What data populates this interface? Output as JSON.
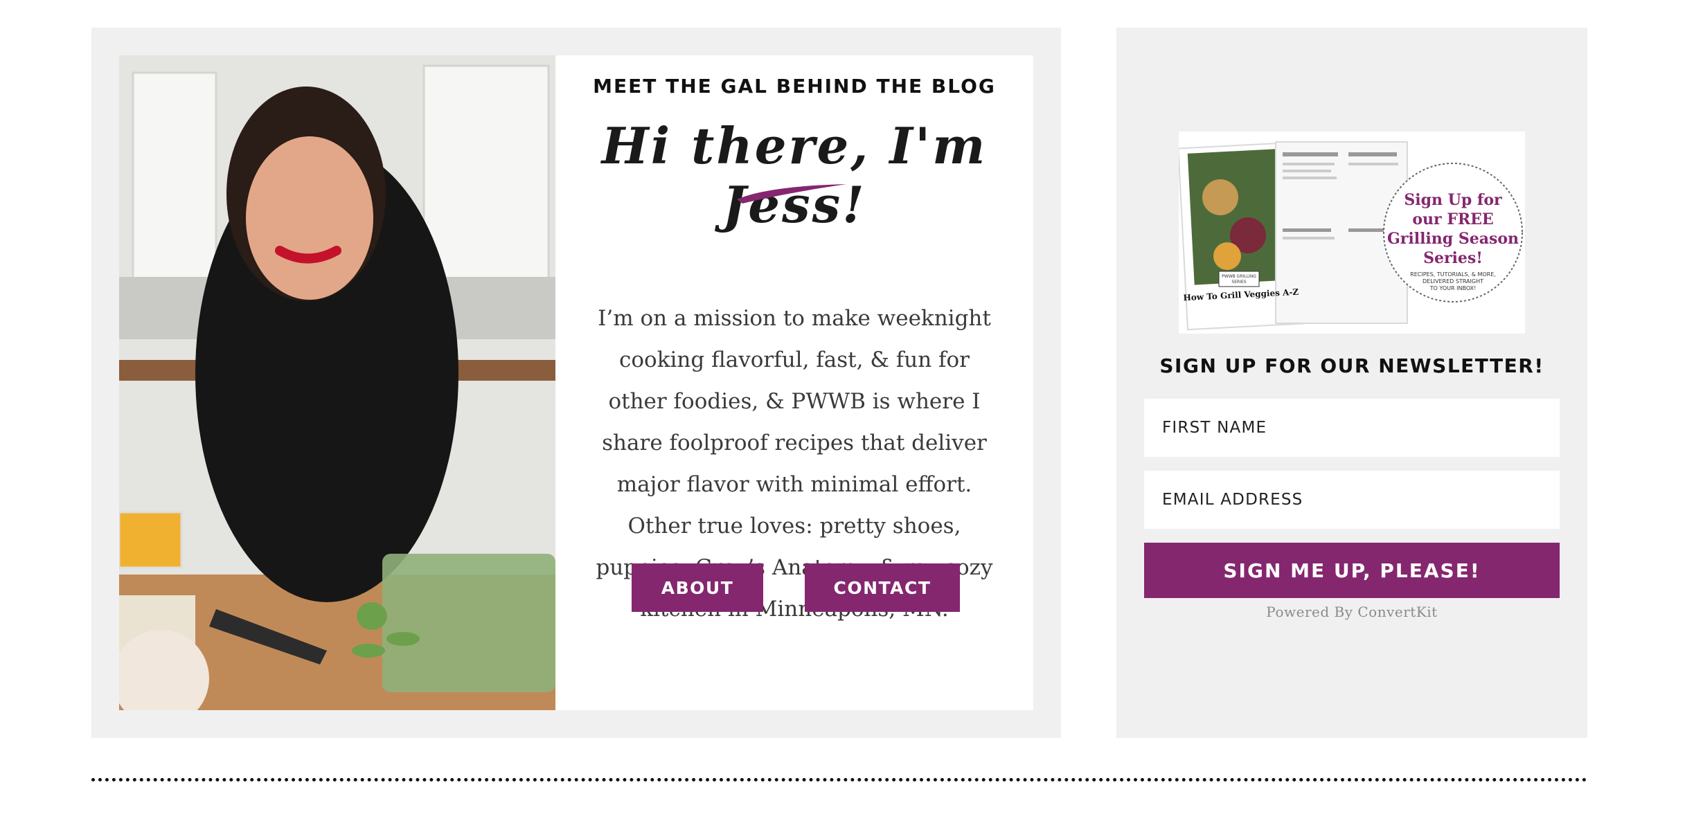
{
  "about": {
    "eyebrow": "MEET THE GAL BEHIND THE BLOG",
    "greeting": "Hi there, I'm Jess!",
    "bio": "I’m on a mission to make weeknight cooking flavorful, fast, & fun for other foodies, & PWWB is where I share foolproof recipes that deliver major flavor with minimal effort. Other true loves: pretty shoes, puppies, Grey’s Anatomy, & my cozy kitchen in Minneapolis, MN.",
    "about_button": "ABOUT",
    "contact_button": "CONTACT"
  },
  "promo": {
    "badge_title": "Sign Up for our FREE Grilling Season Series!",
    "badge_subtitle": "RECIPES, TUTORIALS, & MORE, DELIVERED STRAIGHT TO YOUR INBOX!",
    "booklet_title": "How To Grill Veggies A-Z",
    "booklet_label": "PWWB GRILLING SERIES"
  },
  "newsletter": {
    "heading": "SIGN UP FOR OUR NEWSLETTER!",
    "first_name_placeholder": "FIRST NAME",
    "email_placeholder": "EMAIL ADDRESS",
    "submit_label": "SIGN ME UP, PLEASE!",
    "powered_by": "Powered By ConvertKit"
  },
  "colors": {
    "brand_purple": "#84276f",
    "panel_gray": "#f0f0f0"
  },
  "icons": [
    "brush-stroke-icon"
  ]
}
